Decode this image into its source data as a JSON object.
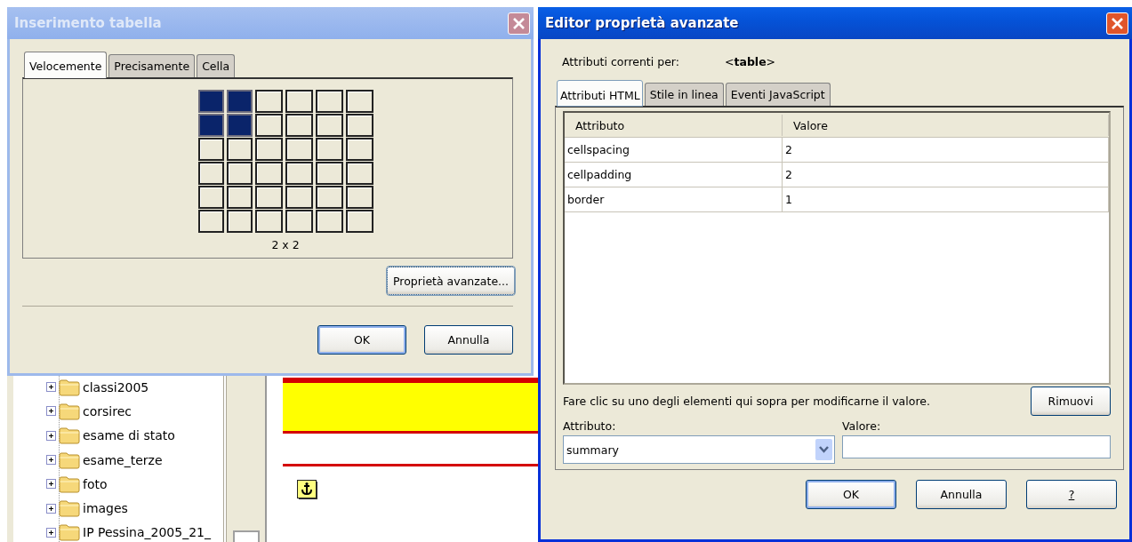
{
  "insert_dialog": {
    "title": "Inserimento tabella",
    "active": false,
    "tabs": [
      {
        "label": "Velocemente",
        "selected": true
      },
      {
        "label": "Precisamente",
        "selected": false
      },
      {
        "label": "Cella",
        "selected": false
      }
    ],
    "grid": {
      "rows": [
        {
          "cells": [
            {
              "selected": true
            },
            {
              "selected": true
            },
            {
              "selected": false
            },
            {
              "selected": false
            },
            {
              "selected": false
            },
            {
              "selected": false
            }
          ]
        },
        {
          "cells": [
            {
              "selected": true
            },
            {
              "selected": true
            },
            {
              "selected": false
            },
            {
              "selected": false
            },
            {
              "selected": false
            },
            {
              "selected": false
            }
          ]
        },
        {
          "cells": [
            {
              "selected": false
            },
            {
              "selected": false
            },
            {
              "selected": false
            },
            {
              "selected": false
            },
            {
              "selected": false
            },
            {
              "selected": false
            }
          ]
        },
        {
          "cells": [
            {
              "selected": false
            },
            {
              "selected": false
            },
            {
              "selected": false
            },
            {
              "selected": false
            },
            {
              "selected": false
            },
            {
              "selected": false
            }
          ]
        },
        {
          "cells": [
            {
              "selected": false
            },
            {
              "selected": false
            },
            {
              "selected": false
            },
            {
              "selected": false
            },
            {
              "selected": false
            },
            {
              "selected": false
            }
          ]
        },
        {
          "cells": [
            {
              "selected": false
            },
            {
              "selected": false
            },
            {
              "selected": false
            },
            {
              "selected": false
            },
            {
              "selected": false
            },
            {
              "selected": false
            }
          ]
        }
      ]
    },
    "size_label": "2 x 2",
    "advanced_button": "Proprietà avanzate...",
    "buttons": [
      {
        "label": "OK",
        "default": true,
        "kind": "plain"
      },
      {
        "label": "Annulla",
        "default": false,
        "kind": "plain"
      }
    ]
  },
  "background": {
    "folder_tree": {
      "items": [
        {
          "label": "classi2005",
          "expanded": false
        },
        {
          "label": "corsirec",
          "expanded": false
        },
        {
          "label": "esame di stato",
          "expanded": false
        },
        {
          "label": "esame_terze",
          "expanded": false
        },
        {
          "label": "foto",
          "expanded": false
        },
        {
          "label": "images",
          "expanded": false
        },
        {
          "label": "IP Pessina_2005_21_",
          "expanded": false
        }
      ]
    }
  },
  "editor_dialog": {
    "title": "Editor proprietà avanzate",
    "active": true,
    "current_label": "Attributi correnti per:",
    "current_element": "<**table**>",
    "tabs": [
      {
        "label": "Attributi HTML",
        "selected": true
      },
      {
        "label": "Stile in linea",
        "selected": false
      },
      {
        "label": "Eventi JavaScript",
        "selected": false
      }
    ],
    "table": {
      "columns": [
        "Attributo",
        "Valore"
      ],
      "rows": [
        [
          "cellspacing",
          "2"
        ],
        [
          "cellpadding",
          "2"
        ],
        [
          "border",
          "1"
        ]
      ]
    },
    "hint": "Fare clic su uno degli elementi qui sopra per modificarne il valore.",
    "remove_button": "Rimuovi",
    "attribute_label": "Attributo:",
    "attribute_select": {
      "value": "summary"
    },
    "value_label": "Valore:",
    "buttons": [
      {
        "label": "OK",
        "default": true,
        "kind": "plain"
      },
      {
        "label": "Annulla",
        "default": false,
        "kind": "plain"
      },
      {
        "label": "?",
        "default": false,
        "kind": "help"
      }
    ]
  }
}
